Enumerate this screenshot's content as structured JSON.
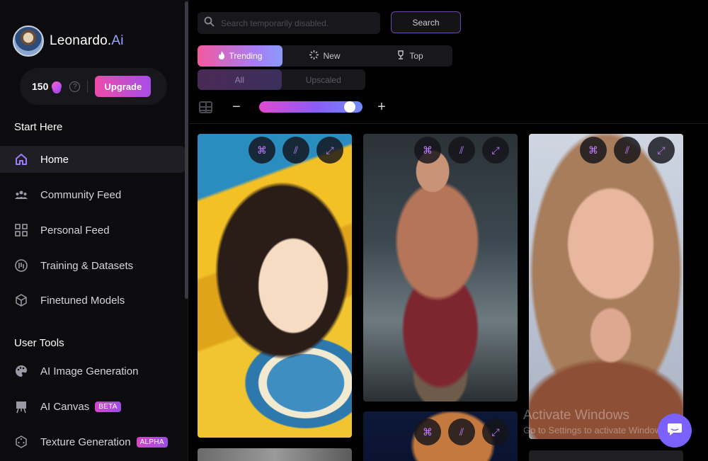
{
  "brand": {
    "name_prefix": "Leonardo.",
    "name_accent": "Ai"
  },
  "credits": {
    "count": "150",
    "help": "?",
    "upgrade_label": "Upgrade"
  },
  "nav": {
    "start_title": "Start Here",
    "start_items": [
      {
        "label": "Home",
        "icon": "home-icon",
        "active": true
      },
      {
        "label": "Community Feed",
        "icon": "community-icon"
      },
      {
        "label": "Personal Feed",
        "icon": "grid-icon"
      },
      {
        "label": "Training & Datasets",
        "icon": "training-icon"
      },
      {
        "label": "Finetuned Models",
        "icon": "cube-icon"
      }
    ],
    "tools_title": "User Tools",
    "tool_items": [
      {
        "label": "AI Image Generation",
        "icon": "palette-icon"
      },
      {
        "label": "AI Canvas",
        "icon": "easel-icon",
        "badge": "BETA"
      },
      {
        "label": "Texture Generation",
        "icon": "dice-icon",
        "badge": "ALPHA"
      }
    ]
  },
  "search": {
    "placeholder": "Search temporarily disabled.",
    "button_label": "Search"
  },
  "tabs": [
    {
      "label": "Trending",
      "icon": "fire-icon",
      "active": true
    },
    {
      "label": "New",
      "icon": "sparkle-icon"
    },
    {
      "label": "Top",
      "icon": "trophy-icon"
    }
  ],
  "filters": [
    {
      "label": "All",
      "active": true
    },
    {
      "label": "Upscaled"
    }
  ],
  "zoom": {
    "minus": "−",
    "plus": "+",
    "level": 0.92
  },
  "gallery_actions": [
    "remix-icon",
    "prompt-icon",
    "expand-icon"
  ],
  "watermark": {
    "line1": "Activate Windows",
    "line2": "Go to Settings to activate Windows."
  },
  "colors": {
    "accent_pink": "#ee4ba8",
    "accent_purple": "#a74de8",
    "chat_button": "#7b61ff"
  }
}
